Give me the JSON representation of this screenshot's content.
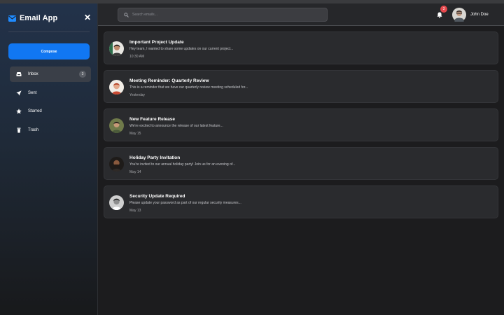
{
  "sidebar": {
    "app_title": "Email App",
    "brand_icon": "envelope-icon",
    "close_glyph": "✕",
    "compose_label": "Compose",
    "items": [
      {
        "label": "Inbox",
        "icon": "inbox-icon",
        "count": "3",
        "active": true
      },
      {
        "label": "Sent",
        "icon": "paper-plane-icon"
      },
      {
        "label": "Starred",
        "icon": "star-icon"
      },
      {
        "label": "Trash",
        "icon": "trash-icon"
      }
    ]
  },
  "header": {
    "search_placeholder": "Search emails...",
    "notifications_count": "3",
    "user_name": "John Doe"
  },
  "emails": [
    {
      "subject": "Important Project Update",
      "preview": "Hey team, I wanted to share some updates on our current project...",
      "date": "10:30 AM"
    },
    {
      "subject": "Meeting Reminder: Quarterly Review",
      "preview": "This is a reminder that we have our quarterly review meeting scheduled for...",
      "date": "Yesterday"
    },
    {
      "subject": "New Feature Release",
      "preview": "We're excited to announce the release of our latest feature...",
      "date": "May 15"
    },
    {
      "subject": "Holiday Party Invitation",
      "preview": "You're invited to our annual holiday party! Join us for an evening of...",
      "date": "May 14"
    },
    {
      "subject": "Security Update Required",
      "preview": "Please update your password as part of our regular security measures...",
      "date": "May 13"
    }
  ],
  "colors": {
    "accent": "#1177f2",
    "notification": "#e5484d",
    "card_background": "#2a2b2e",
    "page_background": "#1c1c1e"
  }
}
